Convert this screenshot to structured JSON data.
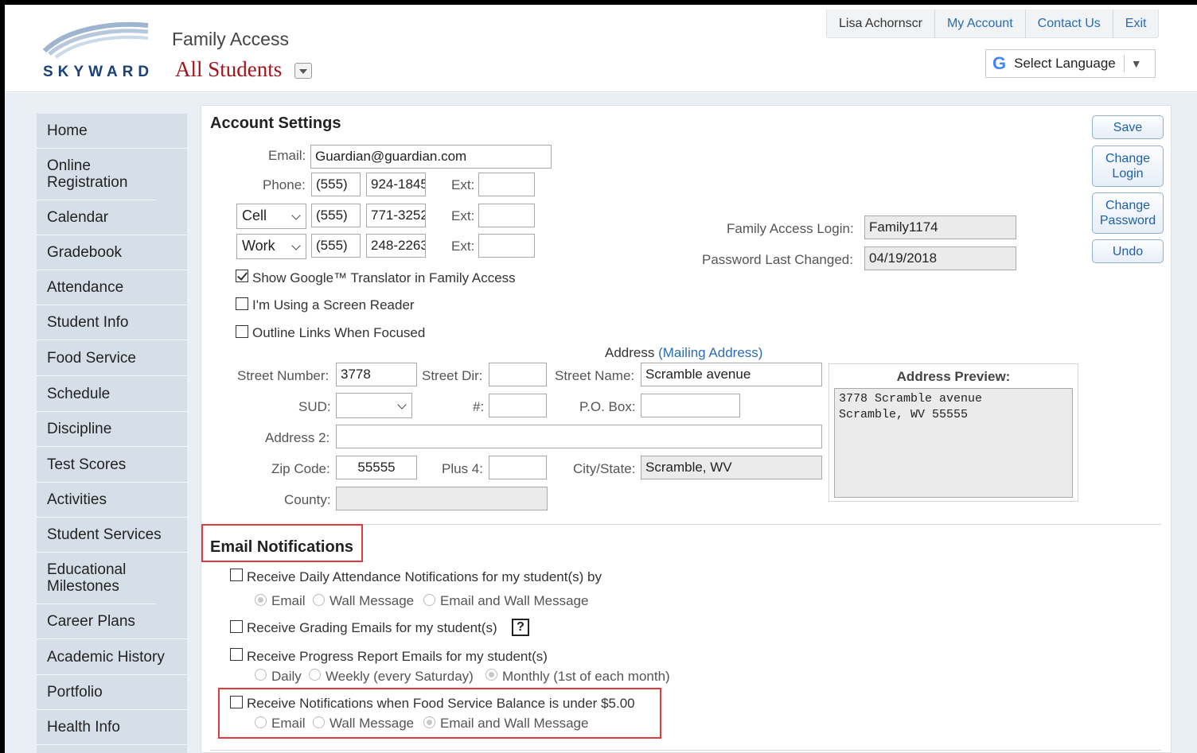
{
  "header": {
    "logo_text": "SKYWARD",
    "app_title": "Family Access",
    "student_selector": "All Students",
    "user_name": "Lisa Achornscr",
    "nav": [
      "My Account",
      "Contact Us",
      "Exit"
    ],
    "language_label": "Select Language",
    "language_icon": "google-g-icon"
  },
  "sidebar": {
    "items": [
      "Home",
      "Online Registration",
      "Calendar",
      "Gradebook",
      "Attendance",
      "Student Info",
      "Food Service",
      "Schedule",
      "Discipline",
      "Test Scores",
      "Activities",
      "Student Services",
      "Educational Milestones",
      "Career Plans",
      "Academic History",
      "Portfolio",
      "Health Info"
    ]
  },
  "account": {
    "title": "Account Settings",
    "email_label": "Email:",
    "email_value": "Guardian@guardian.com",
    "phone_label": "Phone:",
    "ext_label": "Ext:",
    "phones": [
      {
        "type": "",
        "area": "(555)",
        "number": "924-1845",
        "ext": ""
      },
      {
        "type": "Cell",
        "area": "(555)",
        "number": "771-3252",
        "ext": ""
      },
      {
        "type": "Work",
        "area": "(555)",
        "number": "248-2263",
        "ext": ""
      }
    ],
    "login_label": "Family Access Login:",
    "login_value": "Family1174",
    "pw_changed_label": "Password Last Changed:",
    "pw_changed_value": "04/19/2018",
    "options": [
      {
        "label": "Show Google™ Translator in Family Access",
        "checked": true
      },
      {
        "label": "I'm Using a Screen Reader",
        "checked": false
      },
      {
        "label": "Outline Links When Focused",
        "checked": false
      }
    ]
  },
  "buttons": {
    "save": "Save",
    "change_login_1": "Change",
    "change_login_2": "Login",
    "change_password_1": "Change",
    "change_password_2": "Password",
    "undo": "Undo"
  },
  "address": {
    "heading": "Address",
    "heading_link": "(Mailing Address)",
    "street_number_label": "Street Number:",
    "street_number": "3778",
    "street_dir_label": "Street Dir:",
    "street_dir": "",
    "street_name_label": "Street Name:",
    "street_name": "Scramble avenue",
    "sud_label": "SUD:",
    "sud_value": "",
    "hash_label": "#:",
    "hash_value": "",
    "po_box_label": "P.O. Box:",
    "po_box_value": "",
    "address2_label": "Address 2:",
    "address2_value": "",
    "zip_label": "Zip Code:",
    "zip_value": "55555",
    "plus4_label": "Plus 4:",
    "plus4_value": "",
    "city_state_label": "City/State:",
    "city_state_value": "Scramble, WV",
    "county_label": "County:",
    "county_value": "",
    "preview_title": "Address Preview:",
    "preview_text": "3778 Scramble avenue\nScramble, WV 55555"
  },
  "notifications": {
    "title": "Email Notifications",
    "attendance_label": "Receive Daily Attendance Notifications for my student(s) by",
    "attendance_options": [
      "Email",
      "Wall Message",
      "Email and Wall Message"
    ],
    "attendance_selected": 0,
    "grading_label": "Receive Grading Emails for my student(s)",
    "help_glyph": "?",
    "progress_label": "Receive Progress Report Emails for my student(s)",
    "progress_options": [
      "Daily",
      "Weekly (every Saturday)",
      "Monthly (1st of each month)"
    ],
    "progress_selected": 2,
    "food_label": "Receive Notifications when Food Service Balance is under $5.00",
    "food_options": [
      "Email",
      "Wall Message",
      "Email and Wall Message"
    ],
    "food_selected": 2
  },
  "colors": {
    "highlight": "#e0393e",
    "sidebar_bg": "#d6dfe8",
    "link": "#2a6cb3",
    "student_red": "#a2141c"
  }
}
